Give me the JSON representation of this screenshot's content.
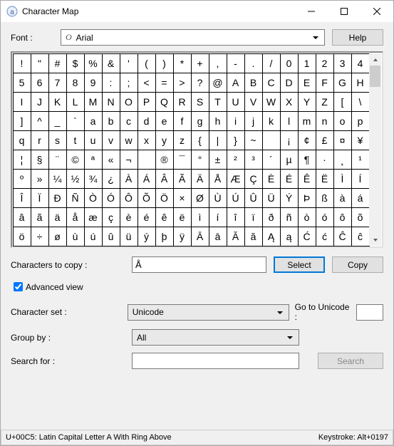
{
  "window": {
    "title": "Character Map"
  },
  "font": {
    "label": "Font :",
    "value": "Arial",
    "help": "Help"
  },
  "grid": {
    "rows": [
      [
        "!",
        "\"",
        "#",
        "$",
        "%",
        "&",
        "'",
        "(",
        ")",
        "*",
        "+",
        ",",
        "-",
        ".",
        "/",
        "0",
        "1",
        "2",
        "3",
        "4"
      ],
      [
        "5",
        "6",
        "7",
        "8",
        "9",
        ":",
        ";",
        "<",
        "=",
        ">",
        "?",
        "@",
        "A",
        "B",
        "C",
        "D",
        "E",
        "F",
        "G",
        "H"
      ],
      [
        "I",
        "J",
        "K",
        "L",
        "M",
        "N",
        "O",
        "P",
        "Q",
        "R",
        "S",
        "T",
        "U",
        "V",
        "W",
        "X",
        "Y",
        "Z",
        "[",
        "\\"
      ],
      [
        "]",
        "^",
        "_",
        "`",
        "a",
        "b",
        "c",
        "d",
        "e",
        "f",
        "g",
        "h",
        "i",
        "j",
        "k",
        "l",
        "m",
        "n",
        "o",
        "p"
      ],
      [
        "q",
        "r",
        "s",
        "t",
        "u",
        "v",
        "w",
        "x",
        "y",
        "z",
        "{",
        "|",
        "}",
        "~",
        " ",
        "¡",
        "¢",
        "£",
        "¤",
        "¥"
      ],
      [
        "¦",
        "§",
        "¨",
        "©",
        "ª",
        "«",
        "¬",
        "­",
        "®",
        "¯",
        "°",
        "±",
        "²",
        "³",
        "´",
        "µ",
        "¶",
        "·",
        "¸",
        "¹"
      ],
      [
        "º",
        "»",
        "¼",
        "½",
        "¾",
        "¿",
        "À",
        "Á",
        "Â",
        "Ã",
        "Ä",
        "Å",
        "Æ",
        "Ç",
        "È",
        "É",
        "Ê",
        "Ë",
        "Ì",
        "Í"
      ],
      [
        "Î",
        "Ï",
        "Ð",
        "Ñ",
        "Ò",
        "Ó",
        "Ô",
        "Õ",
        "Ö",
        "×",
        "Ø",
        "Ù",
        "Ú",
        "Û",
        "Ü",
        "Ý",
        "Þ",
        "ß",
        "à",
        "á"
      ],
      [
        "â",
        "ã",
        "ä",
        "å",
        "æ",
        "ç",
        "è",
        "é",
        "ê",
        "ë",
        "ì",
        "í",
        "î",
        "ï",
        "ð",
        "ñ",
        "ò",
        "ó",
        "ô",
        "õ"
      ],
      [
        "ö",
        "÷",
        "ø",
        "ù",
        "ú",
        "û",
        "ü",
        "ý",
        "þ",
        "ÿ",
        "Ā",
        "ā",
        "Ă",
        "ă",
        "Ą",
        "ą",
        "Ć",
        "ć",
        "Ĉ",
        "ĉ"
      ]
    ]
  },
  "copy": {
    "label": "Characters to copy :",
    "value": "Å",
    "select": "Select",
    "copy": "Copy"
  },
  "advanced": {
    "label": "Advanced view",
    "checked": true
  },
  "charset": {
    "label": "Character set :",
    "value": "Unicode",
    "goto_label": "Go to Unicode :",
    "goto_value": ""
  },
  "groupby": {
    "label": "Group by :",
    "value": "All"
  },
  "search": {
    "label": "Search for :",
    "value": "",
    "button": "Search"
  },
  "status": {
    "left": "U+00C5: Latin Capital Letter A With Ring Above",
    "right": "Keystroke: Alt+0197"
  }
}
